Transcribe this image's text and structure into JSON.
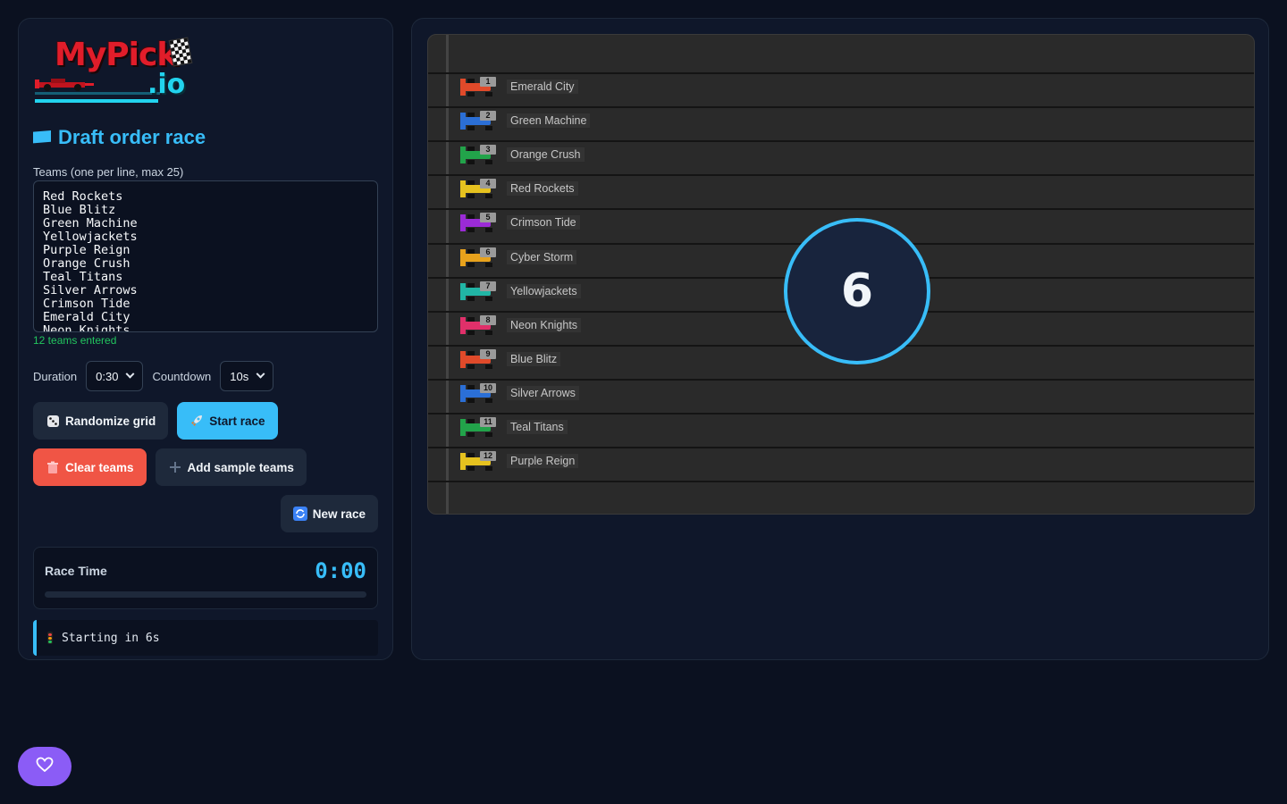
{
  "logo": {
    "text": "MyPick",
    "suffix": ".io"
  },
  "title": "Draft order race",
  "teams": {
    "label": "Teams (one per line, max 25)",
    "value": "Red Rockets\nBlue Blitz\nGreen Machine\nYellowjackets\nPurple Reign\nOrange Crush\nTeal Titans\nSilver Arrows\nCrimson Tide\nEmerald City\nNeon Knights",
    "count_text": "12 teams entered"
  },
  "controls": {
    "duration_label": "Duration",
    "duration_value": "0:30",
    "countdown_label": "Countdown",
    "countdown_value": "10s"
  },
  "buttons": {
    "randomize": "Randomize grid",
    "start": "Start race",
    "clear": "Clear teams",
    "add_sample": "Add sample teams",
    "new_race": "New race"
  },
  "race_time": {
    "label": "Race Time",
    "value": "0:00",
    "progress": 0
  },
  "status": "Starting in 6s",
  "countdown_number": "6",
  "grid": [
    {
      "pos": "1",
      "name": "Emerald City",
      "color": "#e04a2a"
    },
    {
      "pos": "2",
      "name": "Green Machine",
      "color": "#2b6fd6"
    },
    {
      "pos": "3",
      "name": "Orange Crush",
      "color": "#22a34a"
    },
    {
      "pos": "4",
      "name": "Red Rockets",
      "color": "#e6c21f"
    },
    {
      "pos": "5",
      "name": "Crimson Tide",
      "color": "#9b2bd6"
    },
    {
      "pos": "6",
      "name": "Cyber Storm",
      "color": "#e8a21c"
    },
    {
      "pos": "7",
      "name": "Yellowjackets",
      "color": "#21b5a5"
    },
    {
      "pos": "8",
      "name": "Neon Knights",
      "color": "#e0306a"
    },
    {
      "pos": "9",
      "name": "Blue Blitz",
      "color": "#e04a2a"
    },
    {
      "pos": "10",
      "name": "Silver Arrows",
      "color": "#2b6fd6"
    },
    {
      "pos": "11",
      "name": "Teal Titans",
      "color": "#22a34a"
    },
    {
      "pos": "12",
      "name": "Purple Reign",
      "color": "#e6c21f"
    }
  ],
  "icons": {
    "randomize": "dice-icon",
    "start": "rocket-icon",
    "clear": "trash-icon",
    "add_sample": "plus-icon",
    "new_race": "refresh-icon",
    "status": "traffic-light-icon",
    "fav": "heart-icon"
  }
}
